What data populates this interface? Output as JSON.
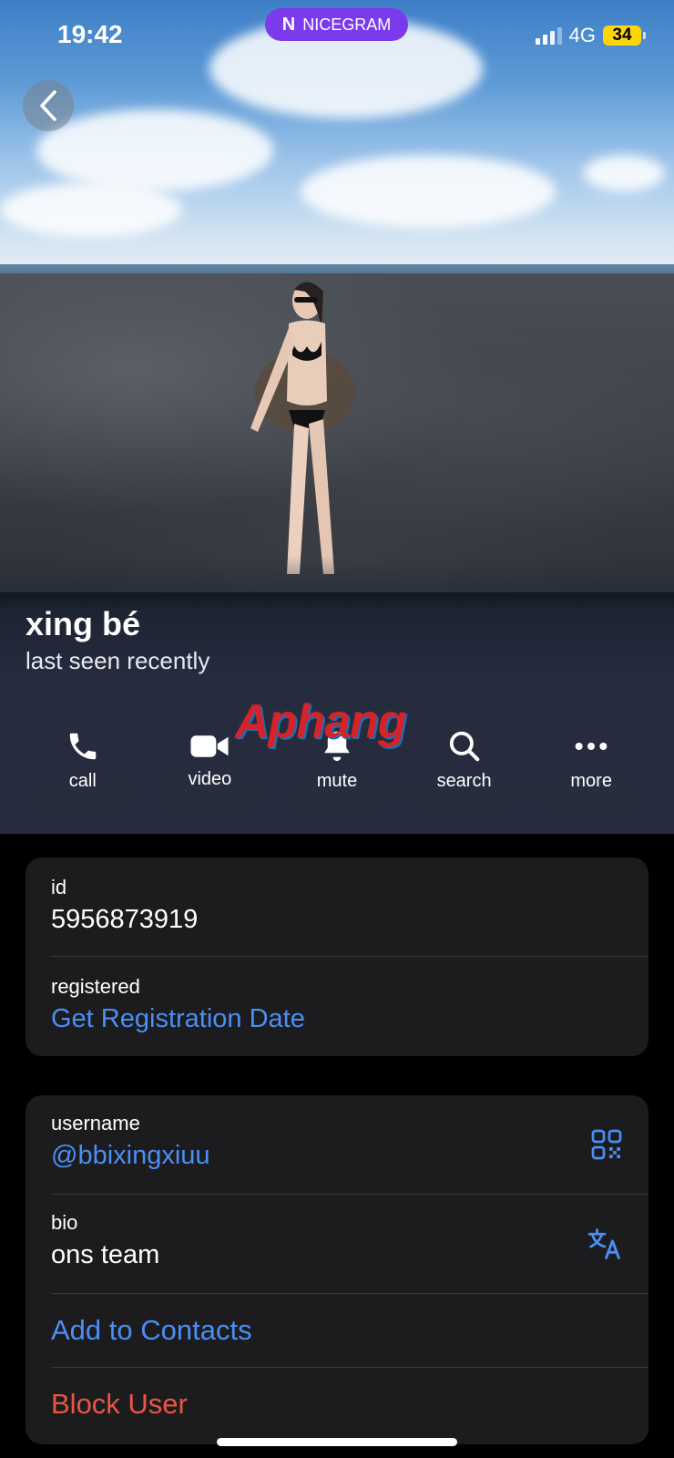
{
  "status_bar": {
    "time": "19:42",
    "app_badge": "NICEGRAM",
    "app_badge_logo": "N",
    "network": "4G",
    "battery": "34",
    "battery_color": "#ffd60a"
  },
  "profile": {
    "name": "xing bé",
    "status": "last seen recently",
    "watermark": "Aphang"
  },
  "actions": [
    {
      "label": "call",
      "icon": "phone-icon"
    },
    {
      "label": "video",
      "icon": "video-camera-icon"
    },
    {
      "label": "mute",
      "icon": "bell-icon"
    },
    {
      "label": "search",
      "icon": "search-icon"
    },
    {
      "label": "more",
      "icon": "more-dots-icon"
    }
  ],
  "info_card": {
    "id_label": "id",
    "id_value": "5956873919",
    "registered_label": "registered",
    "registered_action": "Get Registration Date"
  },
  "details_card": {
    "username_label": "username",
    "username_value": "@bbixingxiuu",
    "bio_label": "bio",
    "bio_value": "ons team",
    "add_contacts": "Add to Contacts",
    "block_user": "Block User"
  },
  "colors": {
    "accent_blue": "#4b8ef5",
    "destructive_red": "#eb5545",
    "card_bg": "#1c1c1e",
    "badge_purple": "#7c3aed"
  }
}
